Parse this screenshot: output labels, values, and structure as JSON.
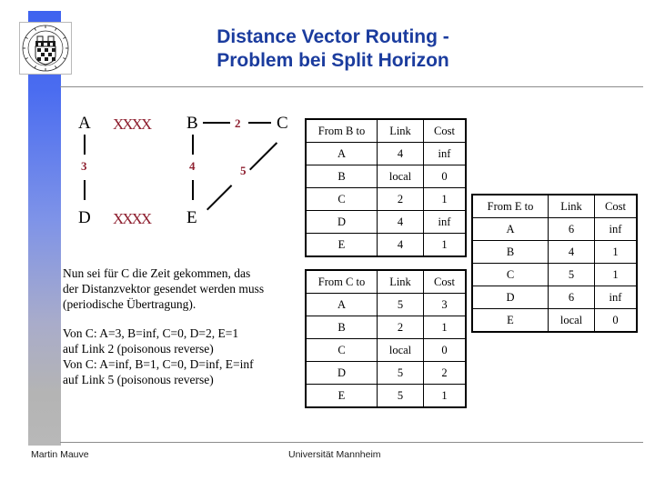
{
  "slide": {
    "title_line1": "Distance Vector Routing -",
    "title_line2": "Problem bei Split Horizon",
    "title_color": "#1b3c9e"
  },
  "logo": {
    "name": "university-of-mannheim-seal",
    "alt": "Universität Mannheim seal"
  },
  "diagram": {
    "nodes": [
      {
        "id": "A",
        "label": "A"
      },
      {
        "id": "B",
        "label": "B"
      },
      {
        "id": "C",
        "label": "C"
      },
      {
        "id": "D",
        "label": "D"
      },
      {
        "id": "E",
        "label": "E"
      }
    ],
    "link_labels": {
      "ad": "3",
      "be": "4",
      "bc": "2",
      "ec": "5"
    },
    "broken_links": [
      {
        "id": "ab",
        "marker": "XXXX"
      },
      {
        "id": "de",
        "marker": "XXXX"
      }
    ],
    "marker_color": "#8e1f2f",
    "label_color": "#8e1f2f"
  },
  "note": {
    "p1_l1": "Nun sei für C die Zeit gekommen, das",
    "p1_l2": "der Distanzvektor gesendet werden muss",
    "p1_l3": "(periodische Übertragung).",
    "p2_l1": "Von C: A=3, B=inf, C=0, D=2, E=1",
    "p2_l2": "auf Link 2 (poisonous reverse)",
    "p2_l3": "Von C: A=inf, B=1, C=0, D=inf, E=inf",
    "p2_l4": "auf Link 5 (poisonous reverse)"
  },
  "tables": {
    "b": {
      "headers": [
        "From B to",
        "Link",
        "Cost"
      ],
      "rows": [
        [
          "A",
          "4",
          "inf"
        ],
        [
          "B",
          "local",
          "0"
        ],
        [
          "C",
          "2",
          "1"
        ],
        [
          "D",
          "4",
          "inf"
        ],
        [
          "E",
          "4",
          "1"
        ]
      ]
    },
    "c": {
      "headers": [
        "From C to",
        "Link",
        "Cost"
      ],
      "rows": [
        [
          "A",
          "5",
          "3"
        ],
        [
          "B",
          "2",
          "1"
        ],
        [
          "C",
          "local",
          "0"
        ],
        [
          "D",
          "5",
          "2"
        ],
        [
          "E",
          "5",
          "1"
        ]
      ]
    },
    "e": {
      "headers": [
        "From E to",
        "Link",
        "Cost"
      ],
      "rows": [
        [
          "A",
          "6",
          "inf"
        ],
        [
          "B",
          "4",
          "1"
        ],
        [
          "C",
          "5",
          "1"
        ],
        [
          "D",
          "6",
          "inf"
        ],
        [
          "E",
          "local",
          "0"
        ]
      ]
    }
  },
  "footer": {
    "author": "Martin Mauve",
    "institution": "Universität Mannheim"
  }
}
